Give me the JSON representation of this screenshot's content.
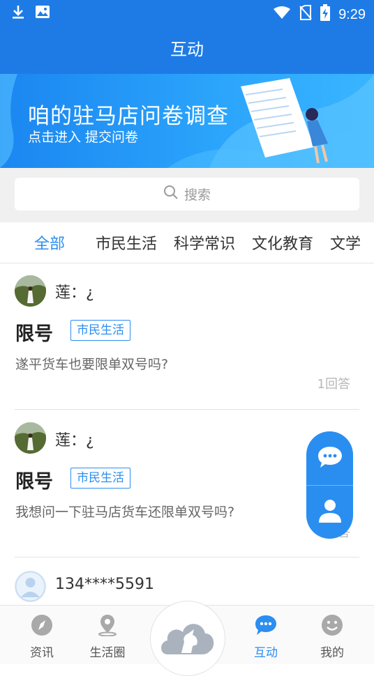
{
  "status_bar": {
    "time": "9:29",
    "icons": [
      "download-icon",
      "image-icon",
      "wifi-icon",
      "no-sim-icon",
      "battery-charging-icon"
    ]
  },
  "header": {
    "title": "互动"
  },
  "banner": {
    "title": "咱的驻马店问卷调查",
    "subtitle": "点击进入 提交问卷"
  },
  "search": {
    "placeholder": "搜索"
  },
  "tabs": [
    {
      "label": "全部",
      "active": true
    },
    {
      "label": "市民生活",
      "active": false
    },
    {
      "label": "科学常识",
      "active": false
    },
    {
      "label": "文化教育",
      "active": false
    },
    {
      "label": "文学",
      "active": false
    }
  ],
  "posts": [
    {
      "username": "莲：¿",
      "title": "限号",
      "tag": "市民生活",
      "body": "遂平货车也要限单双号吗?",
      "answers": "1回答"
    },
    {
      "username": "莲：¿",
      "title": "限号",
      "tag": "市民生活",
      "body": "我想问一下驻马店货车还限单双号吗?",
      "answers": "答"
    },
    {
      "username": "134****5591"
    }
  ],
  "floating_actions": [
    "chat-icon",
    "person-icon"
  ],
  "bottom_nav": [
    {
      "label": "资讯",
      "icon": "compass-icon",
      "active": false
    },
    {
      "label": "生活圈",
      "icon": "location-pin-icon",
      "active": false
    },
    {
      "label": "",
      "icon": "horse-cloud-logo-icon",
      "active": false
    },
    {
      "label": "互动",
      "icon": "chat-bubble-icon",
      "active": true
    },
    {
      "label": "我的",
      "icon": "smiley-icon",
      "active": false
    }
  ],
  "colors": {
    "primary": "#1e7be6",
    "accent": "#2b8ef0",
    "muted_text": "#666666"
  }
}
